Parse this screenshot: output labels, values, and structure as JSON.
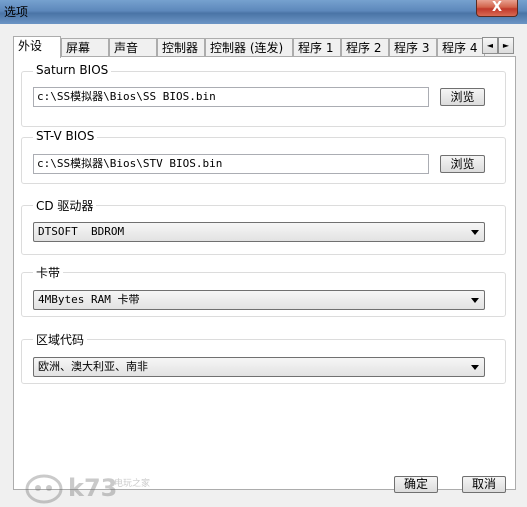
{
  "window": {
    "title": "选项",
    "close_glyph": "X"
  },
  "tabs": [
    {
      "label": "外设"
    },
    {
      "label": "屏幕"
    },
    {
      "label": "声音"
    },
    {
      "label": "控制器"
    },
    {
      "label": "控制器 (连发)"
    },
    {
      "label": "程序 1"
    },
    {
      "label": "程序 2"
    },
    {
      "label": "程序 3"
    },
    {
      "label": "程序 4"
    }
  ],
  "tab_scroll": {
    "left": "◄",
    "right": "►"
  },
  "saturn_bios": {
    "title": "Saturn BIOS",
    "path": "c:\\SS模拟器\\Bios\\SS BIOS.bin",
    "browse_label": "浏览"
  },
  "stv_bios": {
    "title": "ST-V BIOS",
    "path": "c:\\SS模拟器\\Bios\\STV BIOS.bin",
    "browse_label": "浏览"
  },
  "cd_drive": {
    "title": "CD 驱动器",
    "selected": "DTSOFT  BDROM"
  },
  "cartridge": {
    "title": "卡带",
    "selected": "4MBytes RAM 卡带"
  },
  "region": {
    "title": "区域代码",
    "selected": "欧洲、澳大利亚、南非"
  },
  "footer": {
    "ok_label": "确定",
    "cancel_label": "取消"
  },
  "watermark": {
    "text": "k73",
    "subtext": "电玩之家"
  }
}
